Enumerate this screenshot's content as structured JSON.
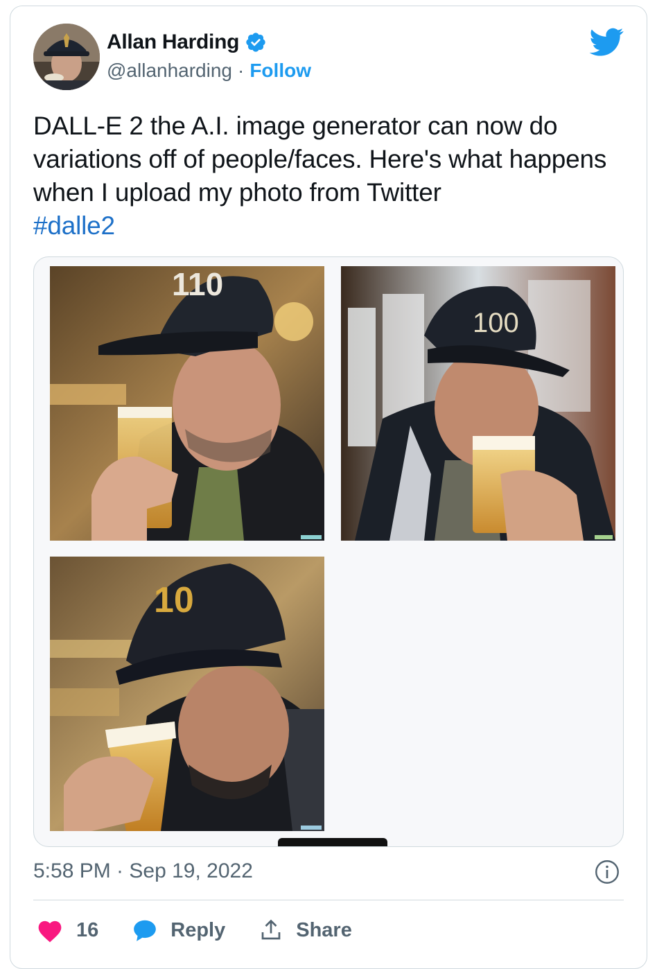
{
  "author": {
    "display_name": "Allan Harding",
    "handle": "@allanharding",
    "separator": "·",
    "follow_label": "Follow",
    "verified": true
  },
  "tweet": {
    "text": "DALL-E 2 the A.I. image generator can now do variations off of people/faces. Here's what happens when I upload my photo from Twitter",
    "hashtag": "#dalle2"
  },
  "media": {
    "images": [
      {
        "alt": "AI variation 1: man in black cap labeled 110 drinking beer",
        "cap_text": "110"
      },
      {
        "alt": "AI variation 2: man in black cap labeled 100 drinking beer",
        "cap_text": "100"
      },
      {
        "alt": "AI variation 3: man in black cap labeled 10 drinking beer",
        "cap_text": "10"
      }
    ]
  },
  "footer": {
    "timestamp": "5:58 PM · Sep 19, 2022"
  },
  "actions": {
    "like_count": "16",
    "reply_label": "Reply",
    "share_label": "Share"
  },
  "colors": {
    "accent": "#1d9bf0",
    "like": "#f91880",
    "text": "#0f1419",
    "muted": "#536471",
    "border": "#cfd9de"
  },
  "icons": [
    "verified-badge-icon",
    "twitter-bird-icon",
    "info-icon",
    "heart-icon",
    "reply-bubble-icon",
    "share-icon"
  ]
}
